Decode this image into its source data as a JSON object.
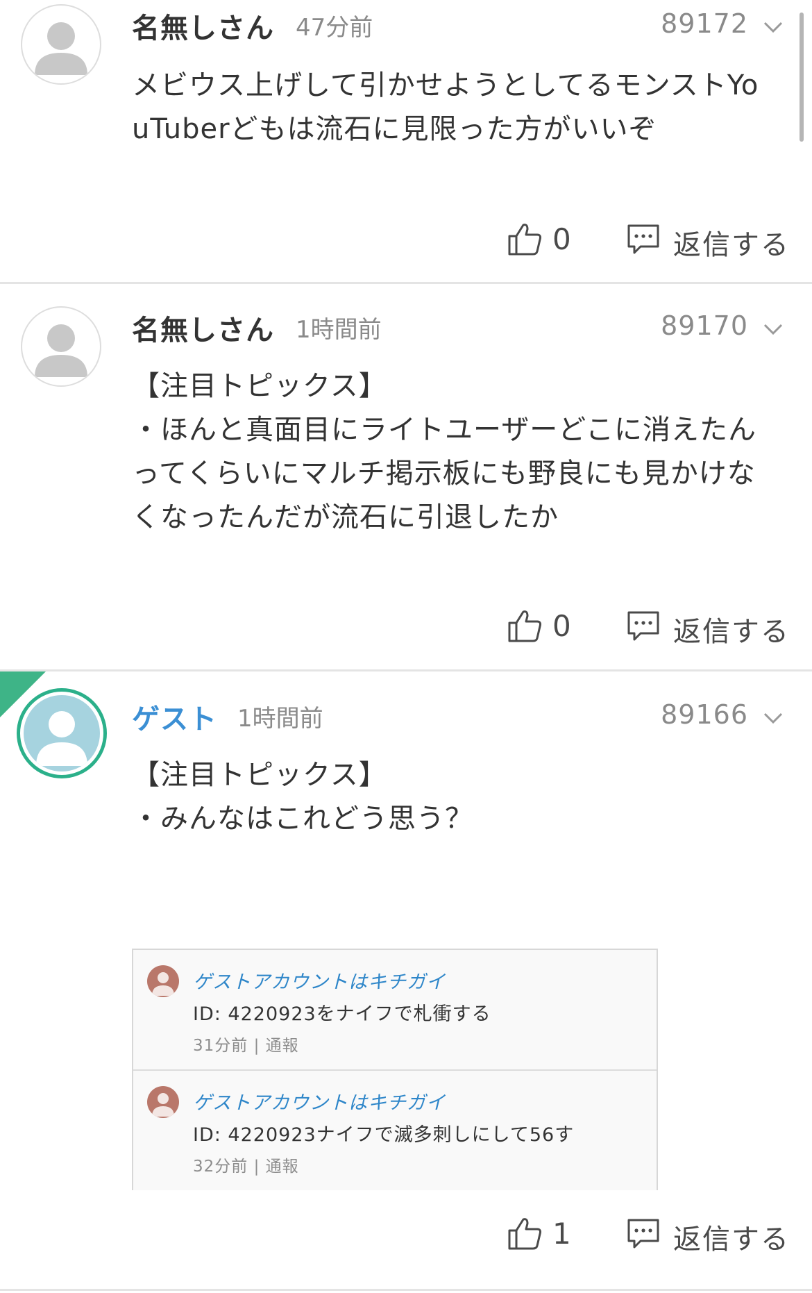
{
  "comments": [
    {
      "author": "名無しさん",
      "time": "47分前",
      "number": "89172",
      "body": "メビウス上げして引かせようとしてるモンストYo\nuTuberどもは流石に見限った方がいいぞ",
      "likes": "0",
      "reply_label": "返信する",
      "avatar_icon": "default-user-icon"
    },
    {
      "author": "名無しさん",
      "time": "1時間前",
      "number": "89170",
      "body": "【注目トピックス】\n・ほんと真面目にライトユーザーどこに消えたん\nってくらいにマルチ掲示板にも野良にも見かけな\nくなったんだが流石に引退したか",
      "likes": "0",
      "reply_label": "返信する",
      "avatar_icon": "default-user-icon"
    },
    {
      "author": "ゲスト",
      "time": "1時間前",
      "number": "89166",
      "body": "【注目トピックス】\n・みんなはこれどう思う？",
      "likes": "1",
      "reply_label": "返信する",
      "avatar_icon": "guest-user-icon",
      "embedded": [
        {
          "user": "ゲストアカウントはキチガイ",
          "text": "ID: 4220923をナイフで札衝する",
          "meta": "31分前 |  通報"
        },
        {
          "user": "ゲストアカウントはキチガイ",
          "text": "ID: 4220923ナイフで滅多刺しにして56す",
          "meta": "32分前 |  通報"
        }
      ]
    }
  ],
  "colors": {
    "guest_accent": "#2bb08a",
    "guest_name": "#3b8fd4",
    "embed_user": "#2e86c9",
    "divider": "#e4e4e4"
  }
}
